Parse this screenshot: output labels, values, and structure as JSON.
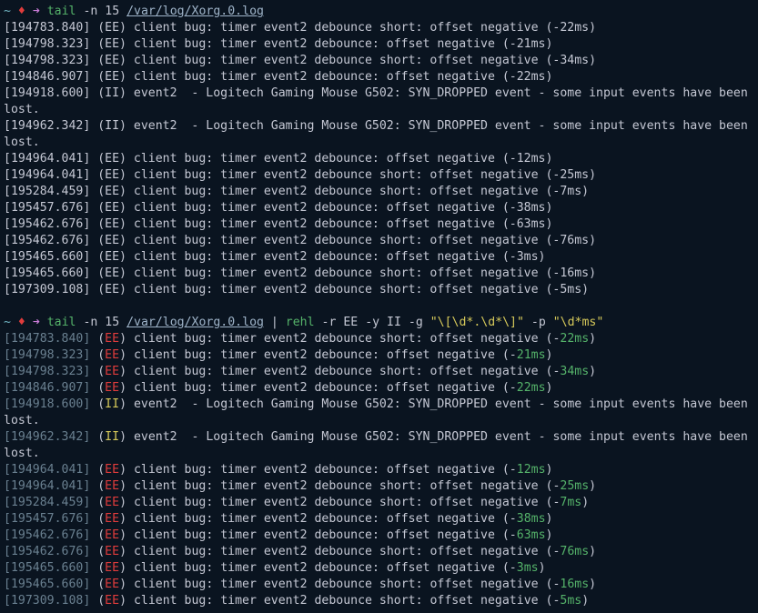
{
  "prompt1": {
    "tilde": "~",
    "diamond": "♦",
    "arrow": "➜",
    "cmd": "tail",
    "flag": "-n 15",
    "path": "/var/log/Xorg.0.log"
  },
  "prompt2": {
    "tilde": "~",
    "diamond": "♦",
    "arrow": "➜",
    "cmd1": "tail",
    "flag1": "-n 15",
    "path": "/var/log/Xorg.0.log",
    "pipe": " | ",
    "cmd2": "rehl",
    "flag_r": "-r",
    "arg_r": "EE",
    "flag_y": "-y",
    "arg_y": "II",
    "flag_g": "-g",
    "arg_g": "\"\\[\\d*.\\d*\\]\"",
    "flag_p": "-p",
    "arg_p": "\"\\d*ms\""
  },
  "log1": [
    "[194783.840] (EE) client bug: timer event2 debounce short: offset negative (-22ms)",
    "[194798.323] (EE) client bug: timer event2 debounce: offset negative (-21ms)",
    "[194798.323] (EE) client bug: timer event2 debounce short: offset negative (-34ms)",
    "[194846.907] (EE) client bug: timer event2 debounce: offset negative (-22ms)",
    "[194918.600] (II) event2  - Logitech Gaming Mouse G502: SYN_DROPPED event - some input events have been lost.",
    "[194962.342] (II) event2  - Logitech Gaming Mouse G502: SYN_DROPPED event - some input events have been lost.",
    "[194964.041] (EE) client bug: timer event2 debounce: offset negative (-12ms)",
    "[194964.041] (EE) client bug: timer event2 debounce short: offset negative (-25ms)",
    "[195284.459] (EE) client bug: timer event2 debounce short: offset negative (-7ms)",
    "[195457.676] (EE) client bug: timer event2 debounce: offset negative (-38ms)",
    "[195462.676] (EE) client bug: timer event2 debounce: offset negative (-63ms)",
    "[195462.676] (EE) client bug: timer event2 debounce short: offset negative (-76ms)",
    "[195465.660] (EE) client bug: timer event2 debounce: offset negative (-3ms)",
    "[195465.660] (EE) client bug: timer event2 debounce short: offset negative (-16ms)",
    "[197309.108] (EE) client bug: timer event2 debounce short: offset negative (-5ms)"
  ],
  "log2": [
    {
      "ts": "[194783.840]",
      "lvl": "EE",
      "mid": " client bug: timer event2 debounce short: offset negative (-",
      "ms": "22ms",
      "tail": ")"
    },
    {
      "ts": "[194798.323]",
      "lvl": "EE",
      "mid": " client bug: timer event2 debounce: offset negative (-",
      "ms": "21ms",
      "tail": ")"
    },
    {
      "ts": "[194798.323]",
      "lvl": "EE",
      "mid": " client bug: timer event2 debounce short: offset negative (-",
      "ms": "34ms",
      "tail": ")"
    },
    {
      "ts": "[194846.907]",
      "lvl": "EE",
      "mid": " client bug: timer event2 debounce: offset negative (-",
      "ms": "22ms",
      "tail": ")"
    },
    {
      "ts": "[194918.600]",
      "lvl": "II",
      "mid": " event2  - Logitech Gaming Mouse G502: SYN_DROPPED event - some input events have been lost.",
      "ms": "",
      "tail": ""
    },
    {
      "ts": "[194962.342]",
      "lvl": "II",
      "mid": " event2  - Logitech Gaming Mouse G502: SYN_DROPPED event - some input events have been lost.",
      "ms": "",
      "tail": ""
    },
    {
      "ts": "[194964.041]",
      "lvl": "EE",
      "mid": " client bug: timer event2 debounce: offset negative (-",
      "ms": "12ms",
      "tail": ")"
    },
    {
      "ts": "[194964.041]",
      "lvl": "EE",
      "mid": " client bug: timer event2 debounce short: offset negative (-",
      "ms": "25ms",
      "tail": ")"
    },
    {
      "ts": "[195284.459]",
      "lvl": "EE",
      "mid": " client bug: timer event2 debounce short: offset negative (-",
      "ms": "7ms",
      "tail": ")"
    },
    {
      "ts": "[195457.676]",
      "lvl": "EE",
      "mid": " client bug: timer event2 debounce: offset negative (-",
      "ms": "38ms",
      "tail": ")"
    },
    {
      "ts": "[195462.676]",
      "lvl": "EE",
      "mid": " client bug: timer event2 debounce: offset negative (-",
      "ms": "63ms",
      "tail": ")"
    },
    {
      "ts": "[195462.676]",
      "lvl": "EE",
      "mid": " client bug: timer event2 debounce short: offset negative (-",
      "ms": "76ms",
      "tail": ")"
    },
    {
      "ts": "[195465.660]",
      "lvl": "EE",
      "mid": " client bug: timer event2 debounce: offset negative (-",
      "ms": "3ms",
      "tail": ")"
    },
    {
      "ts": "[195465.660]",
      "lvl": "EE",
      "mid": " client bug: timer event2 debounce short: offset negative (-",
      "ms": "16ms",
      "tail": ")"
    },
    {
      "ts": "[197309.108]",
      "lvl": "EE",
      "mid": " client bug: timer event2 debounce short: offset negative (-",
      "ms": "5ms",
      "tail": ")"
    }
  ]
}
